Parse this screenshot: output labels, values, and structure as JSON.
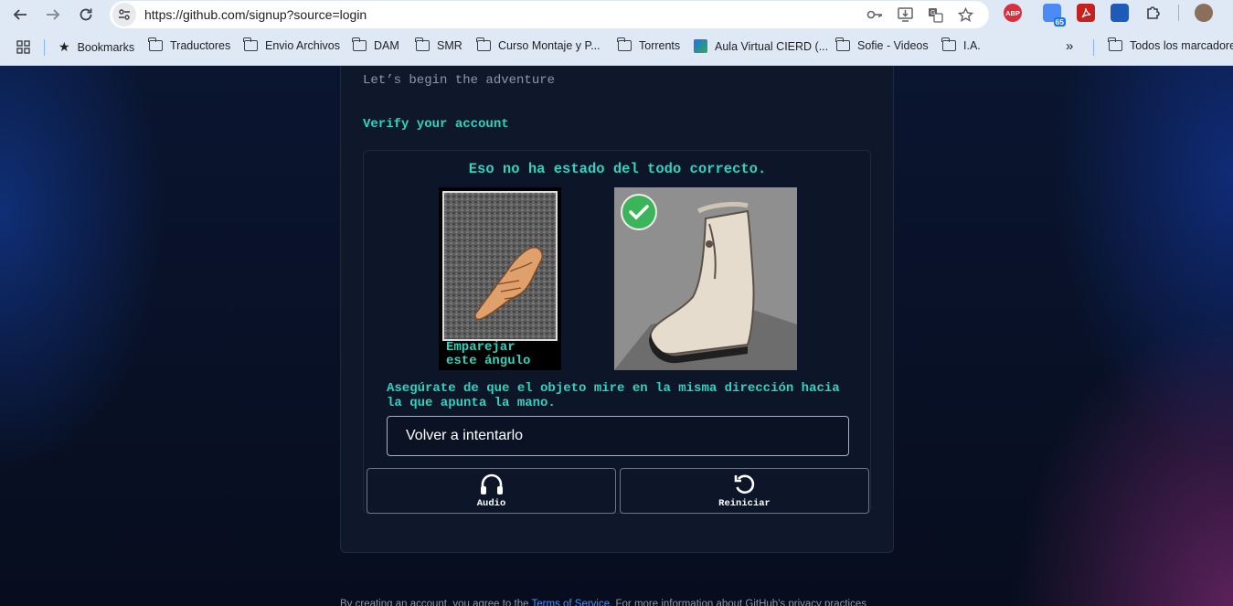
{
  "browser": {
    "url": "https://github.com/signup?source=login",
    "extension_badge": "65",
    "abp_label": "ABP"
  },
  "bookmarks": {
    "items": [
      {
        "label": "Bookmarks",
        "icon": "star-icon"
      },
      {
        "label": "Traductores",
        "icon": "folder-icon"
      },
      {
        "label": "Envio Archivos",
        "icon": "folder-icon"
      },
      {
        "label": "DAM",
        "icon": "folder-icon"
      },
      {
        "label": "SMR",
        "icon": "folder-icon"
      },
      {
        "label": "Curso Montaje y P...",
        "icon": "folder-icon"
      },
      {
        "label": "Torrents",
        "icon": "folder-icon"
      },
      {
        "label": "Aula Virtual CIERD (...",
        "icon": "cierd-favicon"
      },
      {
        "label": "Sofie - Videos",
        "icon": "folder-icon"
      },
      {
        "label": "I.A.",
        "icon": "folder-icon"
      },
      {
        "label": "Todos los marcadores",
        "icon": "folder-icon"
      }
    ]
  },
  "page": {
    "tagline": "Let’s begin the adventure",
    "verify_title": "Verify your account",
    "captcha": {
      "message": "Eso no ha estado del todo correcto.",
      "hand_caption_line1": "Emparejar",
      "hand_caption_line2": "este ángulo",
      "instructions": "Asegúrate de que el objeto mire en la misma dirección hacia la que apunta la mano.",
      "retry_label": "Volver a intentarlo",
      "audio_label": "Audio",
      "reset_label": "Reiniciar"
    },
    "footer": {
      "prefix": "By creating an account, you agree to the ",
      "terms_link": "Terms of Service",
      "suffix": ". For more information about GitHub's privacy practices"
    }
  },
  "colors": {
    "accent": "#2dd4bf",
    "success": "#3cb55a",
    "link": "#4493f8"
  }
}
